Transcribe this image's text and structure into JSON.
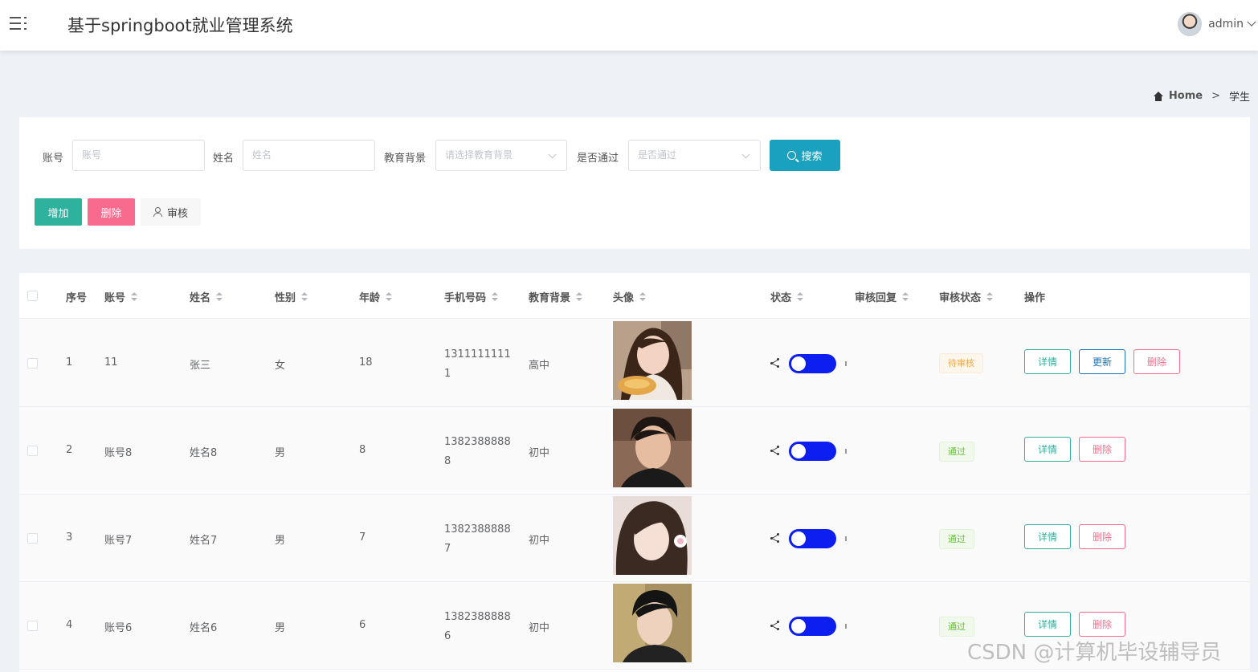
{
  "app": {
    "title": "基于springboot就业管理系统",
    "user": "admin"
  },
  "breadcrumb": {
    "home": "Home",
    "separator": ">",
    "current": "学生"
  },
  "search": {
    "account_label": "账号",
    "account_placeholder": "账号",
    "name_label": "姓名",
    "name_placeholder": "姓名",
    "edu_label": "教育背景",
    "edu_placeholder": "请选择教育背景",
    "pass_label": "是否通过",
    "pass_placeholder": "是否通过",
    "search_button": "搜索"
  },
  "actions": {
    "add": "增加",
    "delete": "删除",
    "audit": "审核"
  },
  "table": {
    "headers": {
      "index": "序号",
      "account": "账号",
      "name": "姓名",
      "gender": "性别",
      "age": "年龄",
      "phone": "手机号码",
      "education": "教育背景",
      "avatar": "头像",
      "status": "状态",
      "reply": "审核回复",
      "audit_status": "审核状态",
      "operation": "操作"
    },
    "buttons": {
      "detail": "详情",
      "update": "更新",
      "delete": "删除"
    },
    "rows": [
      {
        "index": "1",
        "account": "11",
        "name": "张三",
        "gender": "女",
        "age": "18",
        "phone": "13111111111",
        "education": "高中",
        "status_on": true,
        "audit_status": "待审核"
      },
      {
        "index": "2",
        "account": "账号8",
        "name": "姓名8",
        "gender": "男",
        "age": "8",
        "phone": "13823888888",
        "education": "初中",
        "status_on": true,
        "audit_status": "通过"
      },
      {
        "index": "3",
        "account": "账号7",
        "name": "姓名7",
        "gender": "男",
        "age": "7",
        "phone": "13823888887",
        "education": "初中",
        "status_on": true,
        "audit_status": "通过"
      },
      {
        "index": "4",
        "account": "账号6",
        "name": "姓名6",
        "gender": "男",
        "age": "6",
        "phone": "13823888886",
        "education": "初中",
        "status_on": true,
        "audit_status": "通过"
      }
    ]
  },
  "watermark": "CSDN @计算机毕设辅导员",
  "colors": {
    "primary": "#1ba1c0",
    "add": "#2fb29d",
    "danger": "#f86a8e",
    "toggle": "#0d1ff0",
    "pending": "#f0a84a",
    "pass": "#67c23a"
  }
}
